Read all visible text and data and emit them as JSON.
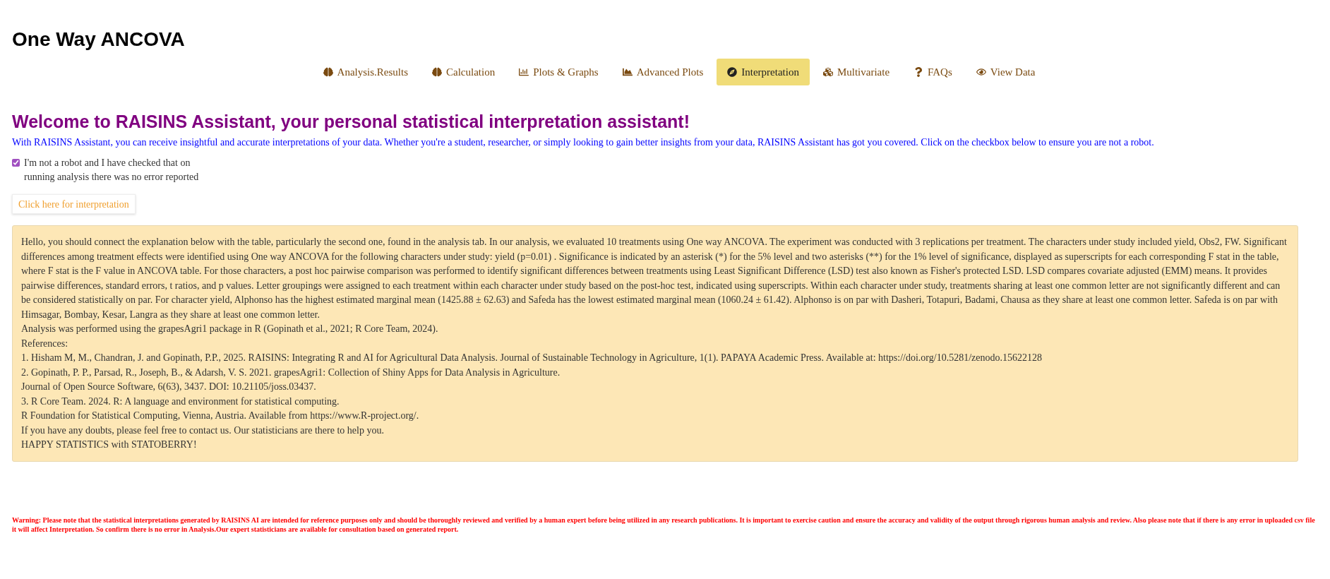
{
  "title": "One Way ANCOVA",
  "tabs": [
    {
      "label": "Analysis.Results",
      "selected": false
    },
    {
      "label": "Calculation",
      "selected": false
    },
    {
      "label": "Plots & Graphs",
      "selected": false
    },
    {
      "label": "Advanced Plots",
      "selected": false
    },
    {
      "label": "Interpretation",
      "selected": true
    },
    {
      "label": "Multivariate",
      "selected": false
    },
    {
      "label": "FAQs",
      "selected": false
    },
    {
      "label": "View Data",
      "selected": false
    }
  ],
  "heading": "Welcome to RAISINS Assistant, your personal statistical interpretation assistant!",
  "intro": "With RAISINS Assistant, you can receive insightful and accurate interpretations of your data. Whether you're a student, researcher, or simply looking to gain better insights from your data, RAISINS Assistant has got you covered. Click on the checkbox below to ensure you are not a robot.",
  "robot_check": {
    "label": "I'm not a robot and I have checked that on running analysis there was no error reported",
    "checked": true
  },
  "interpret_button": "Click here for interpretation",
  "interpretation_lines": [
    "Hello, you should connect the explanation below with the table, particularly the second one, found in the analysis tab. In our analysis, we evaluated 10 treatments using One way ANCOVA. The experiment was conducted with 3 replications per treatment. The characters under study included yield, Obs2, FW. Significant differences among treatment effects were identified using One way ANCOVA for the following characters under study: yield (p=0.01) . Significance is indicated by an asterisk (*) for the 5% level and two asterisks (**) for the 1% level of significance, displayed as superscripts for each corresponding F stat in the table, where F stat is the F value in ANCOVA table. For those characters, a post hoc pairwise comparison was performed to identify significant differences between treatments using Least Significant Difference (LSD) test also known as Fisher's protected LSD. LSD compares covariate adjusted (EMM) means. It provides pairwise differences, standard errors, t ratios, and p values. Letter groupings were assigned to each treatment within each character under study based on the post-hoc test, indicated using superscripts. Within each character under study, treatments sharing at least one common letter are not significantly different and can be considered statistically on par. For character yield, Alphonso has the highest estimated marginal mean (1425.88 ± 62.63) and Safeda has the lowest estimated marginal mean (1060.24 ± 61.42). Alphonso is on par with Dasheri, Totapuri, Badami, Chausa as they share at least one common letter. Safeda is on par with Himsagar, Bombay, Kesar, Langra as they share at least one common letter.",
    "Analysis was performed using the grapesAgri1 package in R (Gopinath et al., 2021; R Core Team, 2024).",
    "References:",
    "1. Hisham M, M., Chandran, J. and Gopinath, P.P., 2025. RAISINS: Integrating R and AI for Agricultural Data Analysis. Journal of Sustainable Technology in Agriculture, 1(1). PAPAYA Academic Press. Available at: https://doi.org/10.5281/zenodo.15622128",
    "2. Gopinath, P. P., Parsad, R., Joseph, B., & Adarsh, V. S. 2021. grapesAgri1: Collection of Shiny Apps for Data Analysis in Agriculture.",
    "Journal of Open Source Software, 6(63), 3437. DOI: 10.21105/joss.03437.",
    "3. R Core Team. 2024. R: A language and environment for statistical computing.",
    "R Foundation for Statistical Computing, Vienna, Austria. Available from https://www.R-project.org/.",
    "If you have any doubts, please feel free to contact us. Our statisticians are there to help you.",
    "HAPPY STATISTICS with STATOBERRY!"
  ],
  "warning": "Warning: Please note that the statistical interpretations generated by RAISINS AI are intended for reference purposes only and should be thoroughly reviewed and verified by a human expert before being utilized in any research publications. It is important to exercise caution and ensure the accuracy and validity of the output through rigorous human analysis and review. Also please note that if there is any error in uploaded csv file it will affect Interpretation. So confirm there is no error in Analysis.Our expert statisticians are available for consultation based on generated report."
}
